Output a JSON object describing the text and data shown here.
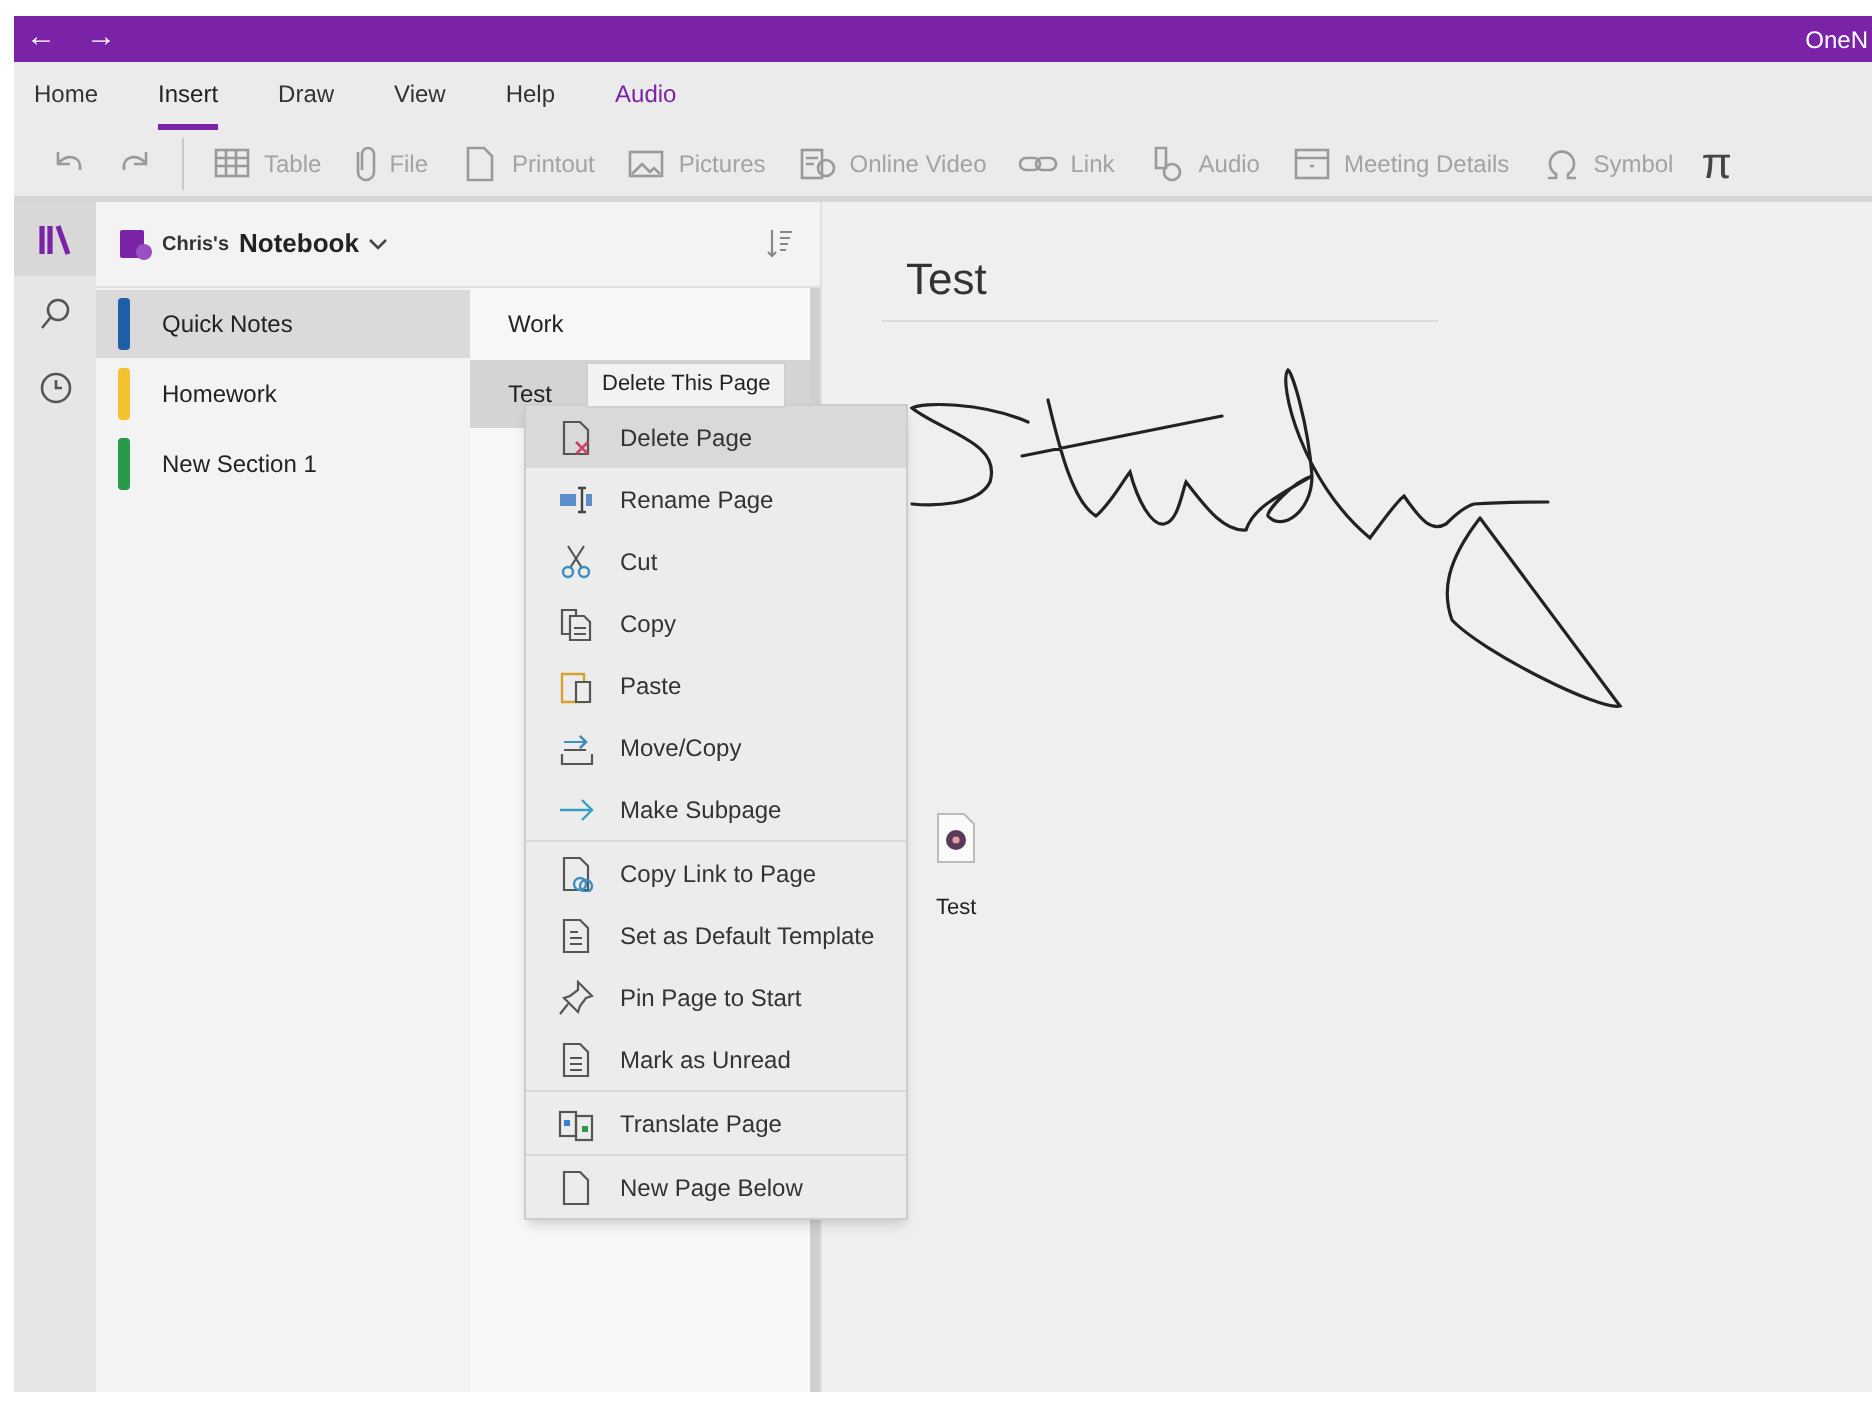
{
  "window": {
    "title": "OneN",
    "back": "←",
    "forward": "→"
  },
  "ribbon_tabs": [
    {
      "label": "Home",
      "selected": false,
      "contextual": false
    },
    {
      "label": "Insert",
      "selected": true,
      "contextual": false
    },
    {
      "label": "Draw",
      "selected": false,
      "contextual": false
    },
    {
      "label": "View",
      "selected": false,
      "contextual": false
    },
    {
      "label": "Help",
      "selected": false,
      "contextual": false
    },
    {
      "label": "Audio",
      "selected": false,
      "contextual": true
    }
  ],
  "toolbar": {
    "items": [
      {
        "label": "Table",
        "disabled": true
      },
      {
        "label": "File",
        "disabled": true
      },
      {
        "label": "Printout",
        "disabled": true
      },
      {
        "label": "Pictures",
        "disabled": true
      },
      {
        "label": "Online Video",
        "disabled": true
      },
      {
        "label": "Link",
        "disabled": true
      },
      {
        "label": "Audio",
        "disabled": true
      },
      {
        "label": "Meeting Details",
        "disabled": true
      },
      {
        "label": "Symbol",
        "disabled": true
      }
    ],
    "equation_glyph": "π"
  },
  "rail": [
    {
      "selected": true
    },
    {
      "selected": false
    },
    {
      "selected": false
    }
  ],
  "notebook": {
    "owner": "Chris's",
    "name": "Notebook"
  },
  "sections": [
    {
      "label": "Quick Notes",
      "color": "#1f5fa8",
      "selected": true
    },
    {
      "label": "Homework",
      "color": "#f2c230",
      "selected": false
    },
    {
      "label": "New Section 1",
      "color": "#2a9a48",
      "selected": false
    }
  ],
  "pages": [
    {
      "label": "Work",
      "selected": false
    },
    {
      "label": "Test",
      "selected": true
    }
  ],
  "tooltip": "Delete This Page",
  "context_menu": [
    [
      {
        "label": "Delete Page",
        "selected": true
      },
      {
        "label": "Rename Page",
        "selected": false
      },
      {
        "label": "Cut",
        "selected": false
      },
      {
        "label": "Copy",
        "selected": false
      },
      {
        "label": "Paste",
        "selected": false
      },
      {
        "label": "Move/Copy",
        "selected": false
      },
      {
        "label": "Make Subpage",
        "selected": false
      }
    ],
    [
      {
        "label": "Copy Link to Page",
        "selected": false
      },
      {
        "label": "Set as Default Template",
        "selected": false
      },
      {
        "label": "Pin Page to Start",
        "selected": false
      },
      {
        "label": "Mark as Unread",
        "selected": false
      }
    ],
    [
      {
        "label": "Translate Page",
        "selected": false
      }
    ],
    [
      {
        "label": "New Page Below",
        "selected": false
      }
    ]
  ],
  "page": {
    "title": "Test",
    "attachment": {
      "label": "Test"
    }
  }
}
